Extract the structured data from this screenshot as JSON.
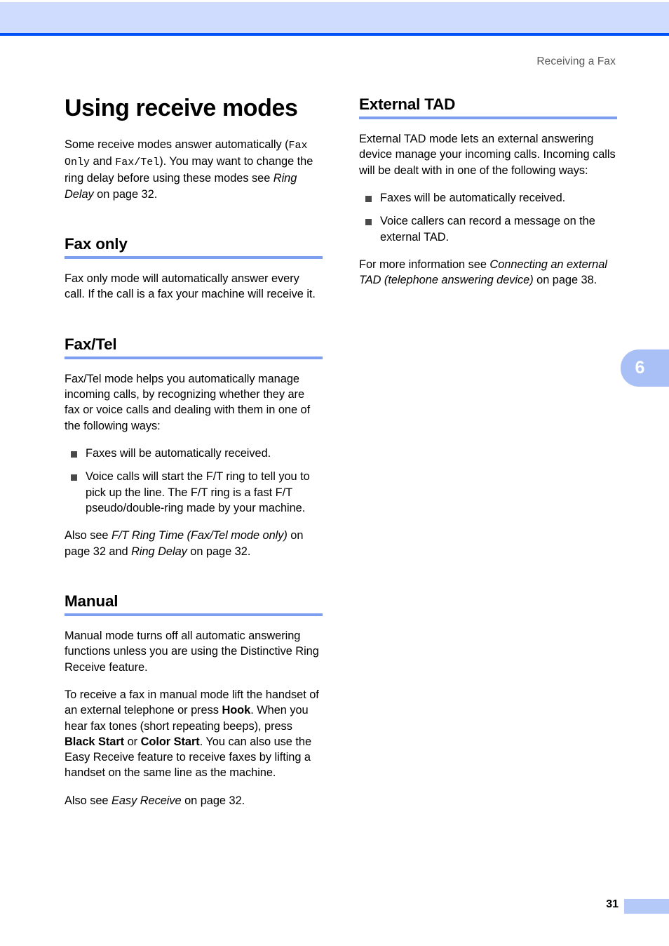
{
  "header": {
    "running_head": "Receiving a Fax"
  },
  "chapter_tab": {
    "number": "6"
  },
  "footer": {
    "page_number": "31"
  },
  "colors": {
    "band_light_blue": "#cfdcfd",
    "band_rule_blue": "#0052f5",
    "heading_rule_blue": "#7e9ff0",
    "tab_blue": "#a8c0f5",
    "footer_block_blue": "#b4c9f8",
    "bullet_gray": "#4a4a4a",
    "running_head_gray": "#58585a"
  },
  "left_column": {
    "page_title": "Using receive modes",
    "intro": {
      "part1": "Some receive modes answer automatically (",
      "mono1": "Fax Only",
      "part2": " and ",
      "mono2": "Fax/Tel",
      "part3": "). You may want to change the ring delay before using these modes see ",
      "italic1": "Ring Delay",
      "part4": " on page 32."
    },
    "sections": [
      {
        "heading": "Fax only",
        "paragraphs": [
          "Fax only mode will automatically answer every call. If the call is a fax your machine will receive it."
        ]
      },
      {
        "heading": "Fax/Tel",
        "intro": "Fax/Tel mode helps you automatically manage incoming calls, by recognizing whether they are fax or voice calls and dealing with them in one of the following ways:",
        "bullets": [
          "Faxes will be automatically received.",
          "Voice calls will start the F/T ring to tell you to pick up the line. The F/T ring is a fast F/T pseudo/double-ring made by your machine."
        ],
        "see_also": {
          "lead": "Also see ",
          "italic1": "F/T Ring Time (Fax/Tel mode only)",
          "mid": " on page 32 and ",
          "italic2": "Ring Delay",
          "tail": " on page 32."
        }
      },
      {
        "heading": "Manual",
        "paragraph1": "Manual mode turns off all automatic answering functions unless you are using the Distinctive Ring Receive feature.",
        "paragraph2": {
          "p1": "To receive a fax in manual mode lift the handset of an external telephone or press ",
          "b1": "Hook",
          "p2": ". When you hear fax tones (short repeating beeps), press ",
          "b2": "Black Start",
          "p3": " or ",
          "b3": "Color Start",
          "p4": ". You can also use the Easy Receive feature to receive faxes by lifting a handset on the same line as the machine."
        },
        "see_also": {
          "lead": "Also see ",
          "italic1": "Easy Receive",
          "tail": " on page 32."
        }
      }
    ]
  },
  "right_column": {
    "sections": [
      {
        "heading": "External TAD",
        "intro": "External TAD mode lets an external answering device manage your incoming calls. Incoming calls will be dealt with in one of the following ways:",
        "bullets": [
          "Faxes will be automatically received.",
          "Voice callers can record a message on the external TAD."
        ],
        "see_also": {
          "lead": "For more information see ",
          "italic1": "Connecting an external TAD (telephone answering device)",
          "tail": " on page 38."
        }
      }
    ]
  }
}
